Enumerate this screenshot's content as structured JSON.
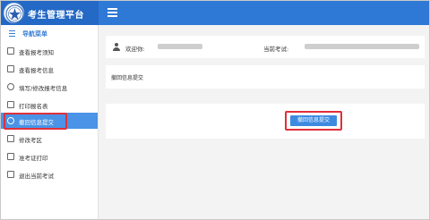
{
  "app": {
    "title": "考生管理平台"
  },
  "sidebar": {
    "header": "导航菜单",
    "items": [
      {
        "label": "查看报考须知",
        "icon": "notice-icon",
        "active": false
      },
      {
        "label": "查看报考信息",
        "icon": "info-icon",
        "active": false
      },
      {
        "label": "填写/修改报考信息",
        "icon": "edit-icon",
        "active": false
      },
      {
        "label": "打印报名表",
        "icon": "print-icon",
        "active": false
      },
      {
        "label": "撤回信息提交",
        "icon": "undo-icon",
        "active": true
      },
      {
        "label": "修改考区",
        "icon": "location-icon",
        "active": false
      },
      {
        "label": "准考证打印",
        "icon": "ticket-icon",
        "active": false
      },
      {
        "label": "退出当前考试",
        "icon": "exit-icon",
        "active": false
      }
    ]
  },
  "user_bar": {
    "welcome_label": "欢迎你:",
    "current_exam_label": "当前考试:"
  },
  "panel": {
    "title": "撤回信息提交"
  },
  "action": {
    "button_label": "撤回信息提交"
  },
  "colors": {
    "topbar": "#2f79d6",
    "brand": "#2469c6",
    "active": "#4a93e6",
    "highlight": "#e0303a",
    "button": "#3d8be0"
  }
}
